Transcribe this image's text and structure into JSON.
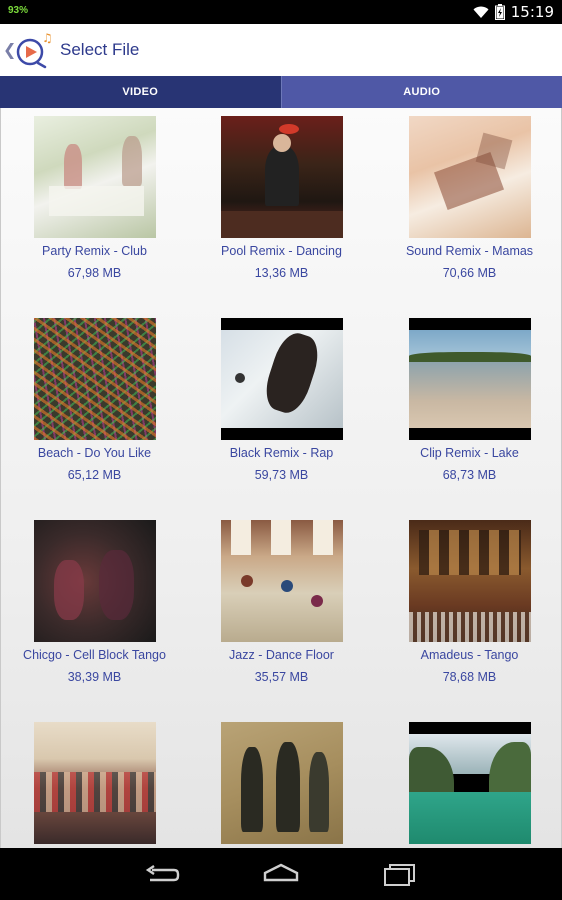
{
  "status": {
    "battery": "93%",
    "time": "15:19"
  },
  "header": {
    "title": "Select File"
  },
  "tabs": [
    {
      "label": "VIDEO"
    },
    {
      "label": "AUDIO"
    }
  ],
  "files": [
    {
      "name": "Party Remix - Club",
      "size": "67,98 MB"
    },
    {
      "name": "Pool Remix - Dancing",
      "size": "13,36 MB"
    },
    {
      "name": "Sound Remix - Mamas",
      "size": "70,66 MB"
    },
    {
      "name": "Beach - Do You Like",
      "size": "65,12 MB"
    },
    {
      "name": "Black Remix - Rap",
      "size": "59,73 MB"
    },
    {
      "name": "Clip Remix - Lake",
      "size": "68,73 MB"
    },
    {
      "name": "Chicgo - Cell Block Tango",
      "size": "38,39 MB"
    },
    {
      "name": "Jazz - Dance Floor",
      "size": "35,57 MB"
    },
    {
      "name": "Amadeus  - Tango",
      "size": "78,68 MB"
    },
    {
      "name": "",
      "size": ""
    },
    {
      "name": "",
      "size": ""
    },
    {
      "name": "",
      "size": ""
    }
  ]
}
